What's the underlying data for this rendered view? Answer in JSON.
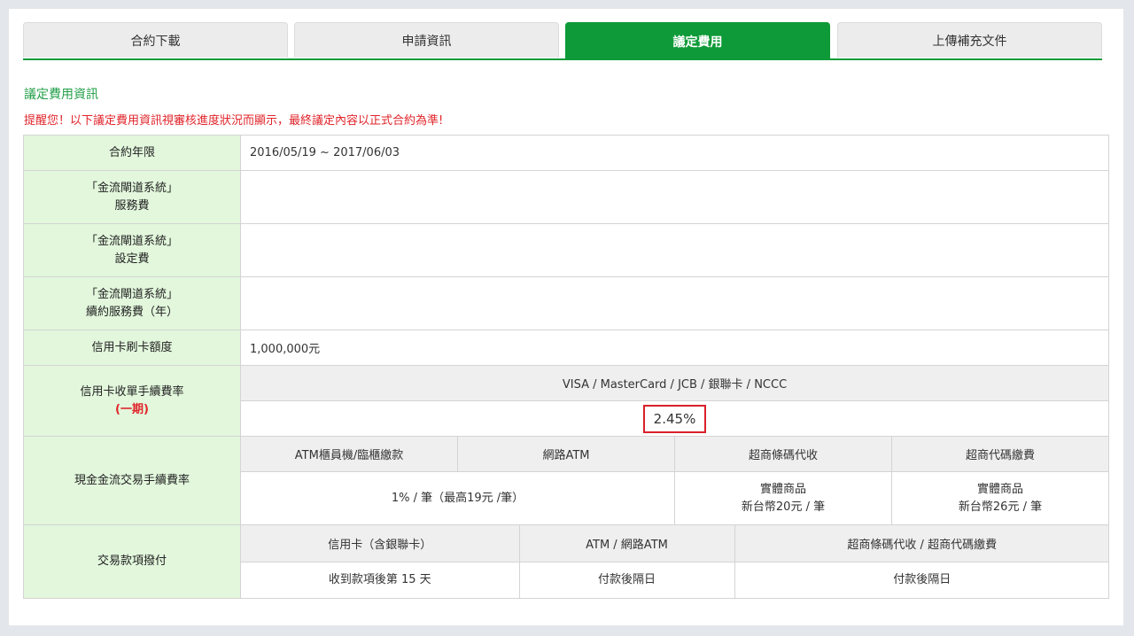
{
  "tabs": [
    {
      "label": "合約下載",
      "active": false
    },
    {
      "label": "申請資訊",
      "active": false
    },
    {
      "label": "議定費用",
      "active": true
    },
    {
      "label": "上傳補充文件",
      "active": false
    }
  ],
  "section_title": "議定費用資訊",
  "notice": "提醒您！以下議定費用資訊視審核進度狀況而顯示，最終議定內容以正式合約為準!",
  "rows": {
    "contract_period": {
      "label": "合約年限",
      "value": "2016/05/19 ~ 2017/06/03"
    },
    "gateway_service_fee": {
      "label_line1": "「金流閘道系統」",
      "label_line2": "服務費",
      "value": ""
    },
    "gateway_setup_fee": {
      "label_line1": "「金流閘道系統」",
      "label_line2": "設定費",
      "value": ""
    },
    "gateway_renewal_fee": {
      "label_line1": "「金流閘道系統」",
      "label_line2": "續約服務費（年）",
      "value": ""
    },
    "credit_limit": {
      "label": "信用卡刷卡額度",
      "value": "1,000,000元"
    },
    "card_fee_rate": {
      "label": "信用卡收單手續費率",
      "label_note": "(一期)",
      "header": "VISA / MasterCard / JCB / 銀聯卡 / NCCC",
      "value": "2.45%"
    },
    "cash_fee_rate": {
      "label": "現金金流交易手續費率",
      "headers": [
        "ATM櫃員機/臨櫃繳款",
        "網路ATM",
        "超商條碼代收",
        "超商代碼繳費"
      ],
      "atm_value": "1% / 筆（最高19元 /筆）",
      "barcode_value_line1": "實體商品",
      "barcode_value_line2": "新台幣20元 / 筆",
      "code_value_line1": "實體商品",
      "code_value_line2": "新台幣26元 / 筆"
    },
    "settlement": {
      "label": "交易款項撥付",
      "headers": [
        "信用卡（含銀聯卡）",
        "ATM / 網路ATM",
        "超商條碼代收 / 超商代碼繳費"
      ],
      "values": [
        "收到款項後第 15 天",
        "付款後隔日",
        "付款後隔日"
      ]
    }
  },
  "colors": {
    "accent_green": "#0e9a38",
    "label_bg": "#e2f7dc",
    "notice_red": "#e0242a",
    "highlight_box": "#d8202a"
  }
}
